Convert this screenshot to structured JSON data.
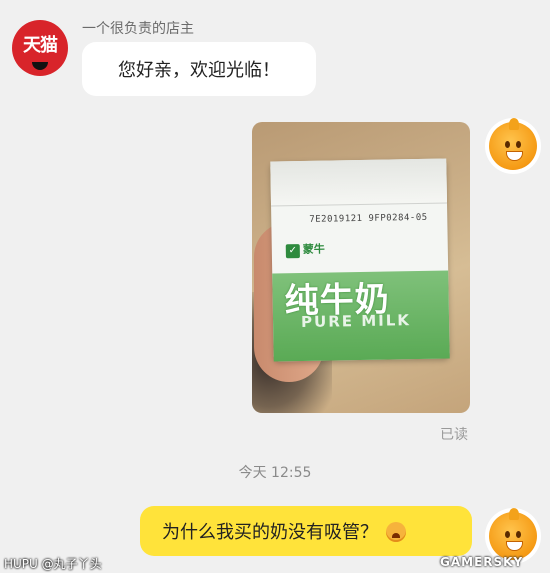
{
  "seller": {
    "avatar_text": "天猫",
    "name": "一个很负责的店主",
    "greeting": "您好亲，欢迎光临！"
  },
  "image_message": {
    "carton_code": "7E2019121 9FP0284-05",
    "brand": "蒙牛",
    "product_name": "纯牛奶",
    "product_english": "PURE MILK",
    "read_status": "已读"
  },
  "timestamp": "今天 12:55",
  "user_message": {
    "text": "为什么我买的奶没有吸管？"
  },
  "watermarks": {
    "left": "HUPU @丸子丫头",
    "right": "GAMERSKY"
  },
  "colors": {
    "background": "#f0f0f0",
    "user_bubble": "#ffe33a",
    "seller_bubble": "#ffffff",
    "tmall_red": "#d8242a"
  }
}
